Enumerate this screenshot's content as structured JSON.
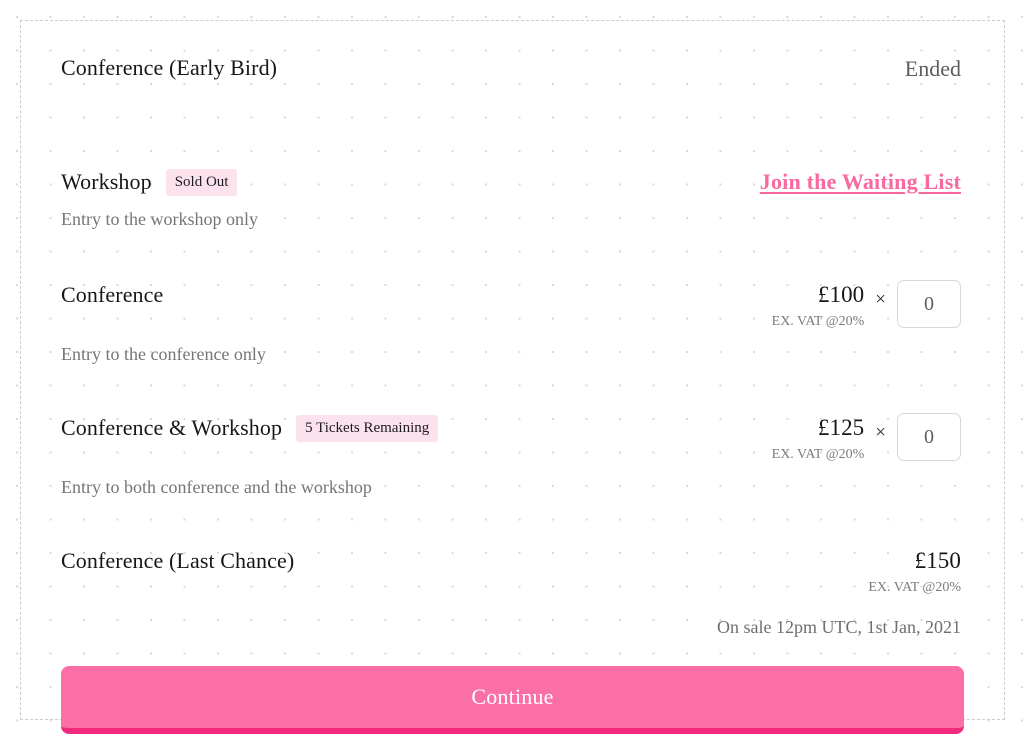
{
  "panel": {
    "rows": [
      {
        "name": "Conference (Early Bird)",
        "badge": null,
        "description": null,
        "status": "Ended",
        "price": null,
        "vat": null,
        "quantity": null
      },
      {
        "name": "Workshop",
        "badge": "Sold Out",
        "description": "Entry to the workshop only",
        "status": null,
        "link": "Join the Waiting List",
        "price": null,
        "vat": null,
        "quantity": null
      },
      {
        "name": "Conference",
        "badge": null,
        "description": "Entry to the conference only",
        "status": null,
        "price": "£100",
        "vat": "EX. VAT @20%",
        "multiply": "×",
        "quantity": "0"
      },
      {
        "name": "Conference & Workshop",
        "badge": "5 Tickets Remaining",
        "description": "Entry to both conference and the workshop",
        "status": null,
        "price": "£125",
        "vat": "EX. VAT @20%",
        "multiply": "×",
        "quantity": "0"
      },
      {
        "name": "Conference (Last Chance)",
        "badge": null,
        "description": null,
        "status": null,
        "price": "£150",
        "vat": "EX. VAT @20%",
        "onsale": "On sale 12pm UTC, 1st Jan, 2021",
        "quantity": null
      }
    ],
    "continue_label": "Continue"
  },
  "colors": {
    "accent_pink": "#fa6fa6",
    "accent_pink_dark": "#f2297c",
    "badge_bg": "#fbe2ec",
    "text_dark": "#17171a",
    "text_muted": "#767676",
    "border_dashed": "#c9ccd3"
  }
}
